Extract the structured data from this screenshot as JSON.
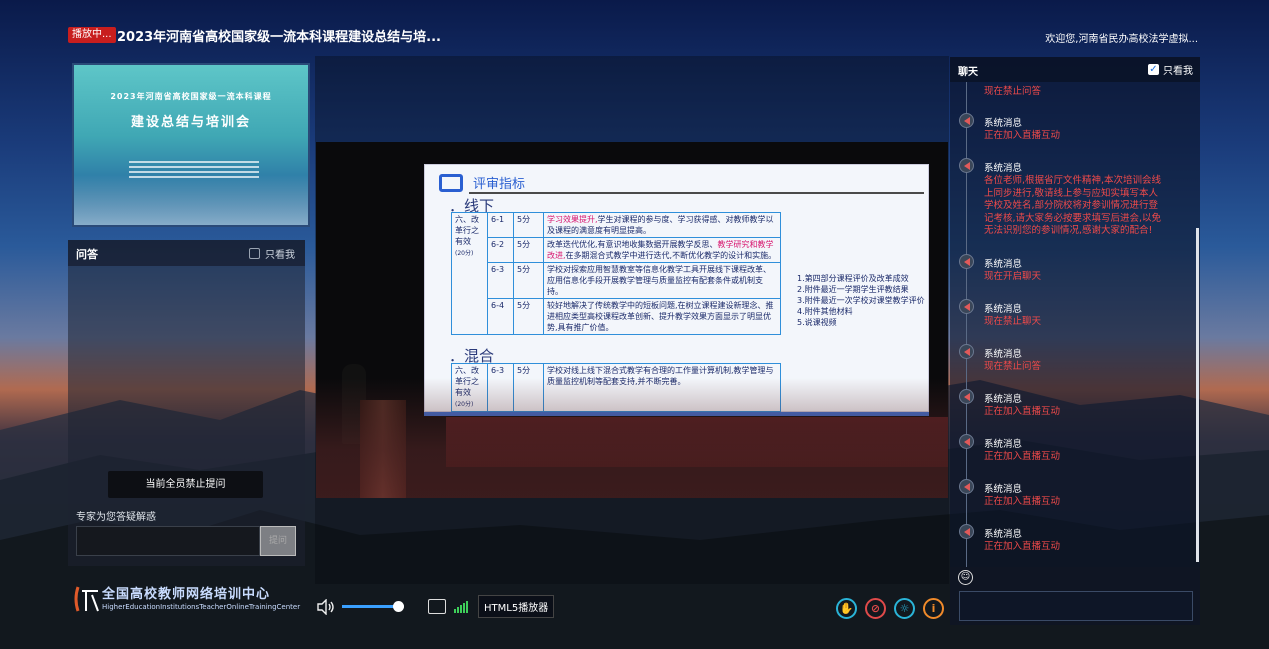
{
  "header": {
    "live_badge": "播放中...",
    "title": "2023年河南省高校国家级一流本科课程建设总结与培...",
    "welcome": "欢迎您,河南省民办高校法学虚拟..."
  },
  "thumbnail": {
    "line1": "2023年河南省高校国家级一流本科课程",
    "line2": "建设总结与培训会"
  },
  "qa": {
    "title": "问答",
    "only_me": "只看我",
    "banned_notice": "当前全员禁止提问",
    "expert_label": "专家为您答疑解惑",
    "submit": "提问"
  },
  "logo": {
    "cn": "全国高校教师网络培训中心",
    "en": "HigherEducationInstitutionsTeacherOnlineTrainingCenter"
  },
  "slide": {
    "heading": "评审指标",
    "section_offline": "．线下",
    "section_mixed": "．混合",
    "category": "六、改革行之有效",
    "category_points": "(20分)",
    "rows": [
      {
        "id": "6-1",
        "score": "5分",
        "text_pink": "学习效果提升,",
        "text": "学生对课程的参与度、学习获得感、对教师教学以及课程的满意度有明显提高。"
      },
      {
        "id": "6-2",
        "score": "5分",
        "text_pre": "改革迭代优化,有意识地收集数据开展教学反思、",
        "text_pink": "教学研究和教学改进,",
        "text": "在多期混合式教学中进行迭代,不断优化教学的设计和实施。"
      },
      {
        "id": "6-3",
        "score": "5分",
        "text": "学校对探索应用智慧教室等信息化教学工具开展线下课程改革、应用信息化手段开展教学管理与质量监控有配套条件或机制支持。"
      },
      {
        "id": "6-4",
        "score": "5分",
        "text": "较好地解决了传统教学中的短板问题,在树立课程建设新理念、推进相应类型高校课程改革创新、提升教学效果方面显示了明显优势,具有推广价值。"
      }
    ],
    "mixed_row": {
      "id": "6-3",
      "score": "5分",
      "text": "学校对线上线下混合式教学有合理的工作量计算机制,教学管理与质量监控机制等配套支持,并不断完善。"
    },
    "notes": [
      "1.第四部分课程评价及改革成效",
      "2.附件最近一学期学生评教结果",
      "3.附件最近一次学校对课堂教学评价",
      "4.附件其他材料",
      "5.说课视频"
    ]
  },
  "player": {
    "volume": 0.9,
    "html5_label": "HTML5播放器"
  },
  "chat": {
    "title": "聊天",
    "only_me": "只看我",
    "messages": [
      {
        "sender": "",
        "text": "现在禁止问答"
      },
      {
        "sender": "系统消息",
        "text": "正在加入直播互动"
      },
      {
        "sender": "系统消息",
        "text": "各位老师,根据省厅文件精神,本次培训会线上同步进行,敬请线上参与应知实填写本人学校及姓名,部分院校将对参训情况进行登记考核,请大家务必按要求填写后进会,以免无法识别您的参训情况,感谢大家的配合!"
      },
      {
        "sender": "系统消息",
        "text": "现在开启聊天"
      },
      {
        "sender": "系统消息",
        "text": "现在禁止聊天"
      },
      {
        "sender": "系统消息",
        "text": "现在禁止问答"
      },
      {
        "sender": "系统消息",
        "text": "正在加入直播互动"
      },
      {
        "sender": "系统消息",
        "text": "正在加入直播互动"
      },
      {
        "sender": "系统消息",
        "text": "正在加入直播互动"
      },
      {
        "sender": "系统消息",
        "text": "正在加入直播互动"
      }
    ]
  },
  "colors": {
    "live_badge": "#c81e1e",
    "chat_alert": "#ef4a4a",
    "slide_accent": "#2a5fd1"
  }
}
